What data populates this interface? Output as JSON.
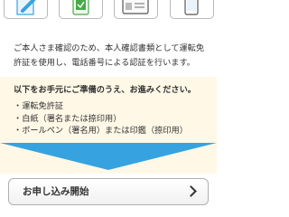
{
  "intro": {
    "text": "ご本人さま確認のため、本人確認書類として運転免許証を使用し、電話番号による認証を行います。"
  },
  "requirements": {
    "title": "以下をお手元にご準備のうえ、お進みください。",
    "items": [
      "運転免許証",
      "白紙（署名または捺印用）",
      "ボールペン（署名用）または印鑑（捺印用）"
    ]
  },
  "cta": {
    "label": "お申し込み開始"
  },
  "colors": {
    "accent_blue": "#36a3e0",
    "panel_background": "#fff8e7",
    "icon_green": "#4aa84a"
  },
  "icons": [
    "pen-document-icon",
    "phone-check-icon",
    "license-card-icon",
    "smartphone-icon"
  ]
}
